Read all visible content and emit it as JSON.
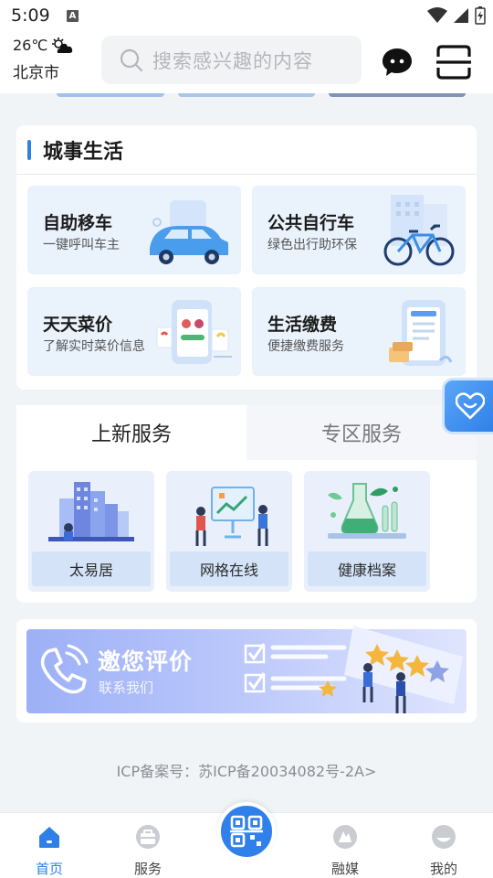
{
  "status_bar": {
    "time": "5:09",
    "notif_icon": "A"
  },
  "header": {
    "weather": {
      "temperature": "26℃",
      "icon": "partly-cloudy-icon",
      "city": "北京市"
    },
    "search": {
      "placeholder": "搜索感兴趣的内容"
    }
  },
  "city_life": {
    "title": "城事生活",
    "tiles": [
      {
        "title": "自助移车",
        "subtitle": "一键呼叫车主",
        "icon": "car-icon"
      },
      {
        "title": "公共自行车",
        "subtitle": "绿色出行助环保",
        "icon": "bicycle-icon"
      },
      {
        "title": "天天菜价",
        "subtitle": "了解实时菜价信息",
        "icon": "vegetable-price-icon"
      },
      {
        "title": "生活缴费",
        "subtitle": "便捷缴费服务",
        "icon": "bill-payment-icon"
      }
    ]
  },
  "services": {
    "tabs": [
      {
        "label": "上新服务",
        "active": true
      },
      {
        "label": "专区服务",
        "active": false
      }
    ],
    "items": [
      {
        "label": "太易居",
        "icon": "city-buildings-icon"
      },
      {
        "label": "网格在线",
        "icon": "presentation-board-icon"
      },
      {
        "label": "健康档案",
        "icon": "health-lab-icon"
      }
    ]
  },
  "evaluate_banner": {
    "title": "邀您评价",
    "subtitle": "联系我们"
  },
  "icp": "ICP备案号：苏ICP备20034082号-2A>",
  "bottom_nav": [
    {
      "label": "首页",
      "icon": "home-icon",
      "active": true
    },
    {
      "label": "服务",
      "icon": "briefcase-icon",
      "active": false
    },
    {
      "label": "",
      "icon": "scan-code-icon",
      "active": false
    },
    {
      "label": "融媒",
      "icon": "media-icon",
      "active": false
    },
    {
      "label": "我的",
      "icon": "profile-icon",
      "active": false
    }
  ],
  "colors": {
    "accent": "#2f7fe8",
    "background": "#f1f4f6",
    "tile_bg": "#eaf2fc"
  }
}
